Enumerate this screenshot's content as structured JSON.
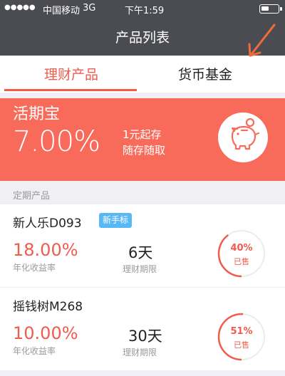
{
  "status_bar": {
    "signal": "●●●●●",
    "carrier": "中国移动",
    "network": "3G",
    "time": "下午1:59"
  },
  "nav": {
    "title": "产品列表"
  },
  "tabs": [
    {
      "label": "理财产品",
      "active": true
    },
    {
      "label": "货币基金",
      "active": false
    }
  ],
  "featured": {
    "name": "活期宝",
    "rate": "7.00%",
    "line1": "1元起存",
    "line2": "随存随取",
    "icon": "piggy-bank-icon"
  },
  "section_title": "定期产品",
  "products": [
    {
      "name": "新人乐D093",
      "badge": "新手标",
      "rate": "18.00%",
      "rate_label": "年化收益率",
      "term": "6天",
      "term_label": "理财期限",
      "sold_percent": "40%",
      "sold_fraction": 0.4,
      "sold_label": "已售"
    },
    {
      "name": "摇钱树M268",
      "rate": "10.00%",
      "rate_label": "年化收益率",
      "term": "30天",
      "term_label": "理财期限",
      "sold_percent": "51%",
      "sold_fraction": 0.51,
      "sold_label": "已售"
    }
  ],
  "colors": {
    "accent": "#f05b4c",
    "banner": "#f86a5a",
    "header": "#4b4c52",
    "badge": "#58b8f5",
    "arrow": "#f26a3a"
  }
}
